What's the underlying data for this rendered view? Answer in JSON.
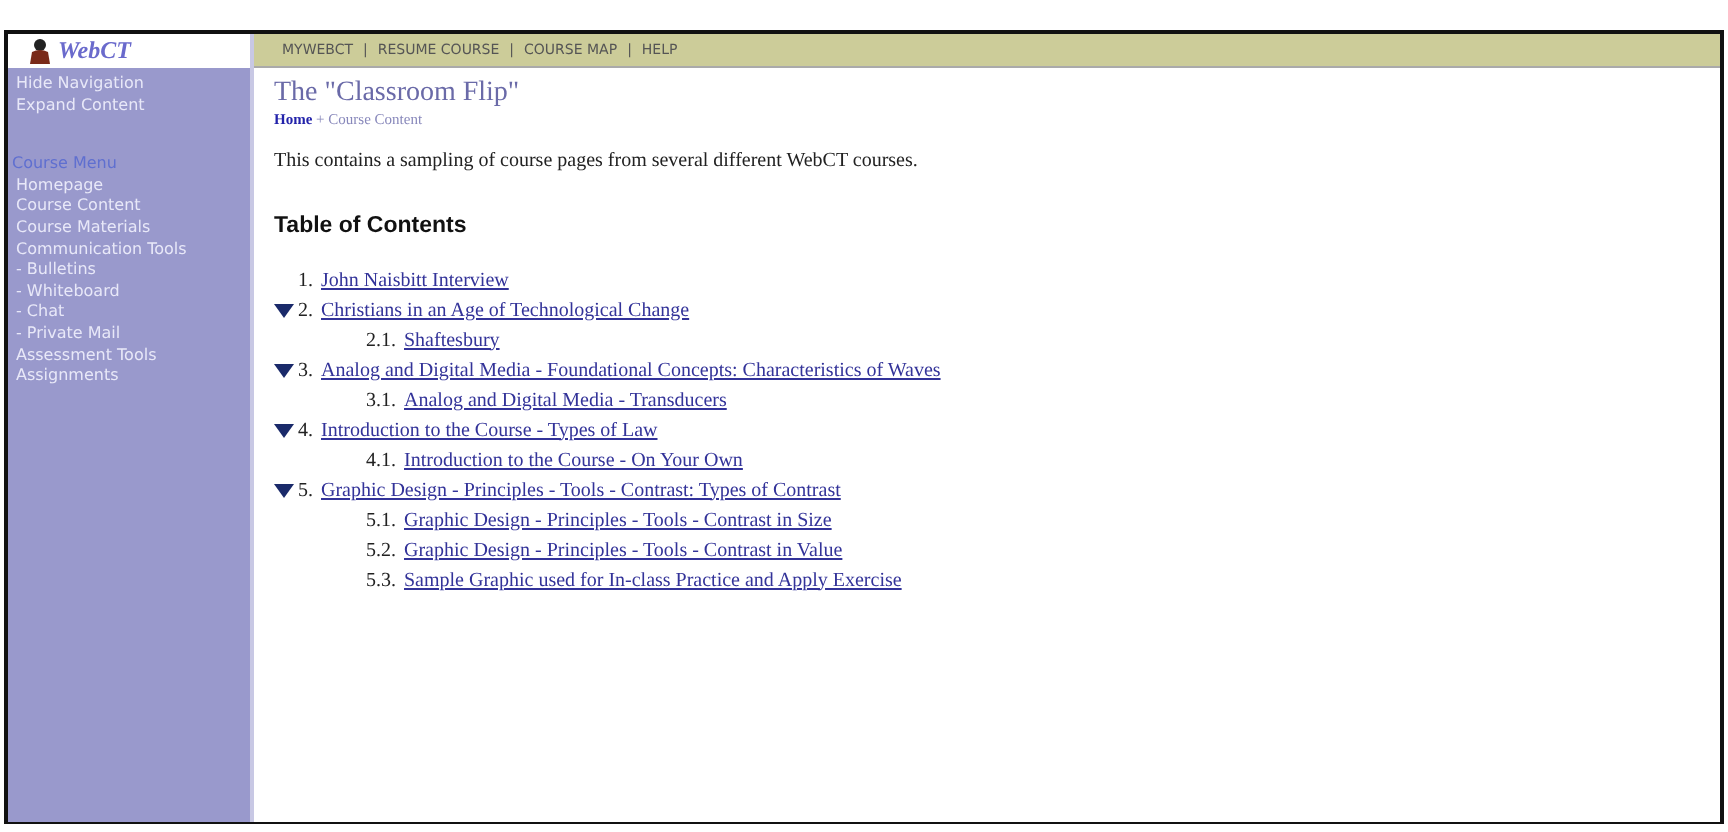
{
  "sidebar": {
    "logo": "WebCT",
    "nav_links": [
      "Hide Navigation",
      "Expand Content"
    ],
    "menu_title": "Course Menu",
    "menu_items": [
      "Homepage",
      "Course Content",
      "Course Materials",
      "Communication Tools",
      "- Bulletins",
      "- Whiteboard",
      "- Chat",
      "- Private Mail",
      "Assessment Tools",
      "Assignments"
    ]
  },
  "top_bar": {
    "links": [
      "MYWEBCT",
      "RESUME COURSE",
      "COURSE MAP",
      "HELP"
    ],
    "separator": "|"
  },
  "page_title": "The \"Classroom Flip\"",
  "breadcrumb": {
    "items": [
      "Home",
      "Course Content"
    ],
    "separator": "+"
  },
  "intro": "This contains a sampling of course pages from several different WebCT courses.",
  "toc_heading": "Table of Contents",
  "toc": [
    {
      "number": "1.",
      "title": "John Naisbitt Interview",
      "expanded": false
    },
    {
      "number": "2.",
      "title": "Christians in an Age of Technological Change",
      "expanded": true,
      "children": [
        {
          "number": "2.1.",
          "title": "Shaftesbury"
        }
      ]
    },
    {
      "number": "3.",
      "title": "Analog and Digital Media - Foundational Concepts: Characteristics of Waves",
      "expanded": true,
      "children": [
        {
          "number": "3.1.",
          "title": "Analog and Digital Media - Transducers"
        }
      ]
    },
    {
      "number": "4.",
      "title": "Introduction to the Course - Types of Law",
      "expanded": true,
      "children": [
        {
          "number": "4.1.",
          "title": "Introduction to the Course - On Your Own"
        }
      ]
    },
    {
      "number": "5.",
      "title": "Graphic Design - Principles - Tools - Contrast: Types of Contrast",
      "expanded": true,
      "children": [
        {
          "number": "5.1.",
          "title": "Graphic Design - Principles - Tools - Contrast in Size"
        },
        {
          "number": "5.2.",
          "title": "Graphic Design - Principles - Tools - Contrast in Value"
        },
        {
          "number": "5.3.",
          "title": "Sample Graphic used for In-class Practice and Apply Exercise"
        }
      ]
    }
  ]
}
